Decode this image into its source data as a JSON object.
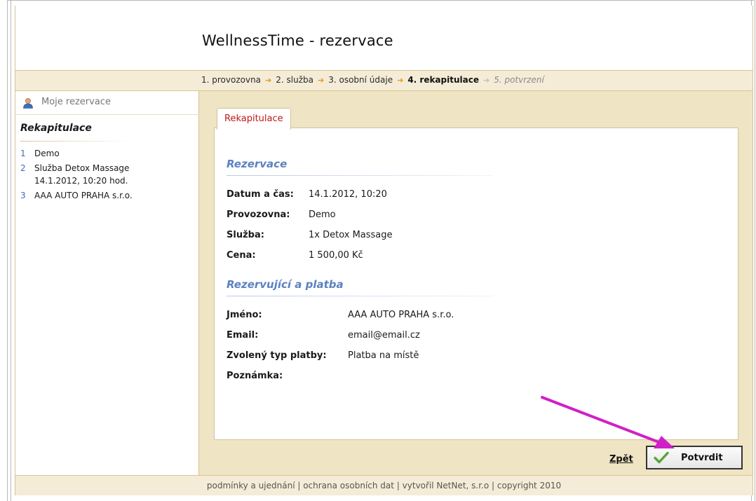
{
  "app": {
    "title": "WellnessTime - rezervace"
  },
  "steps": [
    {
      "label": "1. provozovna",
      "state": "done"
    },
    {
      "label": "2. služba",
      "state": "done"
    },
    {
      "label": "3. osobní údaje",
      "state": "done"
    },
    {
      "label": "4. rekapitulace",
      "state": "current"
    },
    {
      "label": "5. potvrzení",
      "state": "future"
    }
  ],
  "sidebar": {
    "my_reservations": "Moje rezervace",
    "recap_title": "Rekapitulace",
    "items": [
      {
        "num": "1",
        "text": "Demo"
      },
      {
        "num": "2",
        "text": "Služba Detox Massage 14.1.2012, 10:20 hod."
      },
      {
        "num": "3",
        "text": "AAA AUTO PRAHA s.r.o."
      }
    ]
  },
  "main": {
    "tab": "Rekapitulace",
    "reservation": {
      "title": "Rezervace",
      "rows": [
        {
          "label": "Datum a čas:",
          "value": "14.1.2012, 10:20"
        },
        {
          "label": "Provozovna:",
          "value": "Demo"
        },
        {
          "label": "Služba:",
          "value": "1x Detox Massage"
        },
        {
          "label": "Cena:",
          "value": "1 500,00 Kč"
        }
      ]
    },
    "customer": {
      "title": "Rezervující a platba",
      "rows": [
        {
          "label": "Jméno:",
          "value": "AAA AUTO PRAHA s.r.o."
        },
        {
          "label": "Email:",
          "value": "email@email.cz"
        },
        {
          "label": "Zvolený typ platby:",
          "value": "Platba na místě"
        },
        {
          "label": "Poznámka:",
          "value": ""
        }
      ]
    },
    "back_label": "Zpět",
    "confirm_label": "Potvrdit"
  },
  "footer": {
    "text": "podmínky a ujednání | ochrana osobních dat | vytvořil NetNet, s.r.o | copyright 2010"
  },
  "colors": {
    "accent_red": "#c0181c",
    "section_blue": "#5b82c0",
    "arrow_magenta": "#d020c8",
    "step_arrow": "#e09a1a"
  },
  "icons": {
    "user": "user-icon",
    "check": "check-icon",
    "step_arrow": "arrow-right-icon"
  }
}
